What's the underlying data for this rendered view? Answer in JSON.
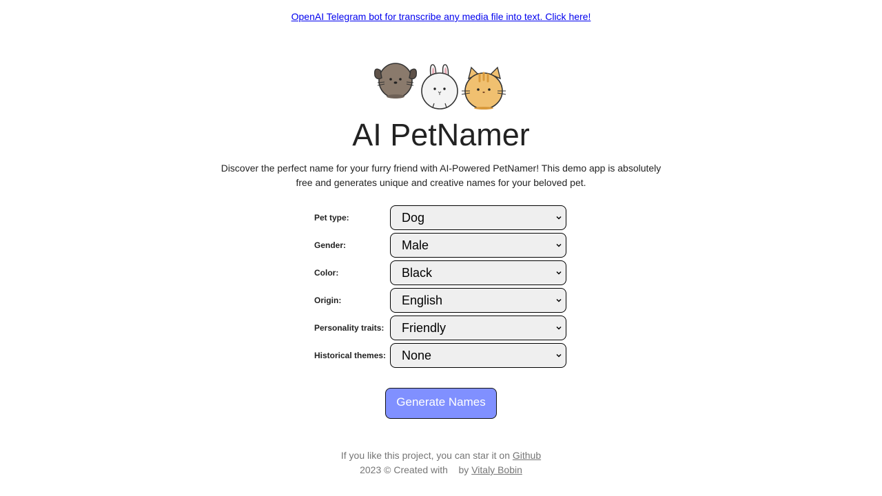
{
  "banner": {
    "link_text": "OpenAI Telegram bot for transcribe any media file into text. Click here!"
  },
  "header": {
    "mascot_icons": [
      "dog-icon",
      "rabbit-icon",
      "cat-icon"
    ],
    "title": "AI PetNamer",
    "description": "Discover the perfect name for your furry friend with AI-Powered PetNamer! This demo app is absolutely free and generates unique and creative names for your beloved pet."
  },
  "form": {
    "fields": [
      {
        "label": "Pet type:",
        "value": "Dog"
      },
      {
        "label": "Gender:",
        "value": "Male"
      },
      {
        "label": "Color:",
        "value": "Black"
      },
      {
        "label": "Origin:",
        "value": "English"
      },
      {
        "label": "Personality traits:",
        "value": "Friendly"
      },
      {
        "label": "Historical themes:",
        "value": "None"
      }
    ],
    "submit_label": "Generate Names"
  },
  "footer": {
    "star_text": "If you like this project, you can star it on",
    "github_link": "Github",
    "created_text": "2023 © Created with",
    "by_text": "by",
    "author_link": "Vitaly Bobin"
  },
  "colors": {
    "button_background": "#8090ff",
    "select_background": "#efefef",
    "link": "#0000ee",
    "footer_text": "#757575"
  }
}
